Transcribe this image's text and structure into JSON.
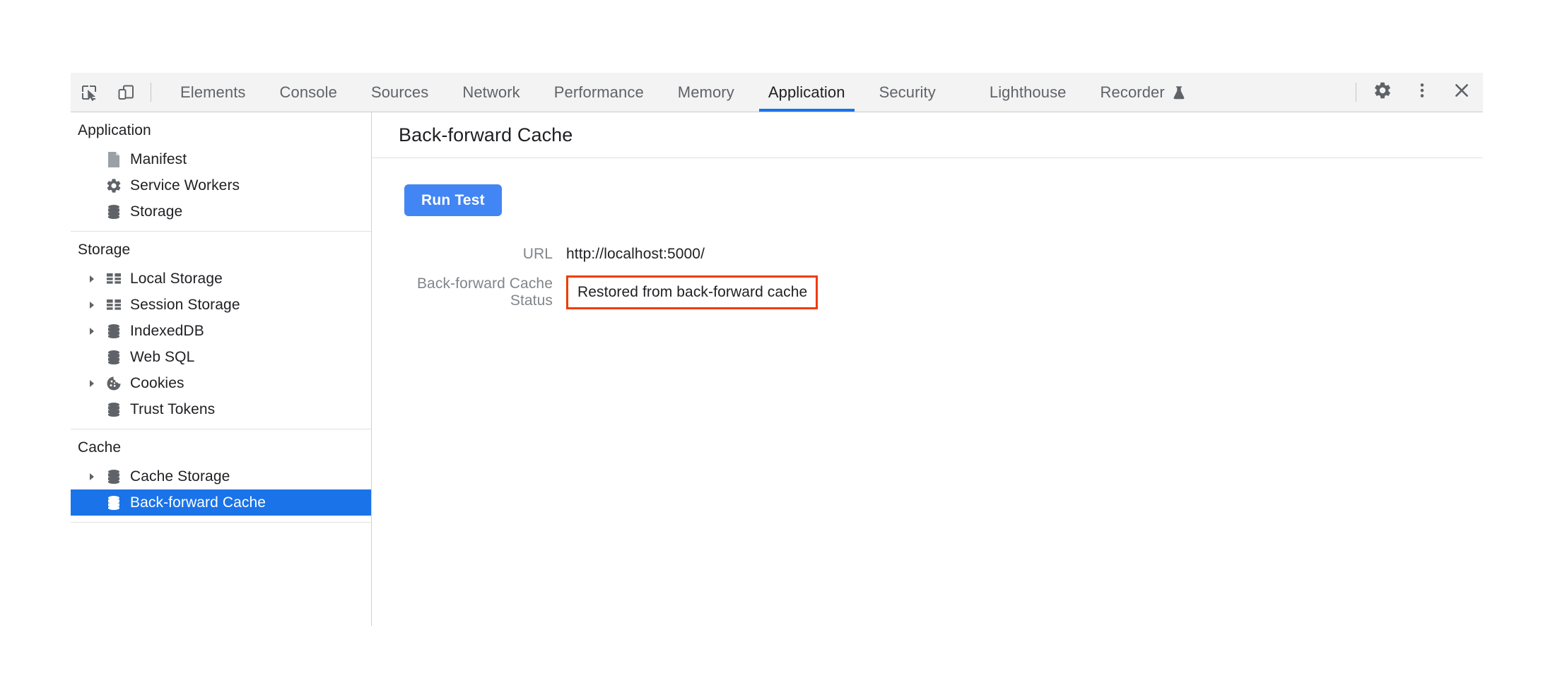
{
  "toolbar": {
    "inspect_icon": "inspect-cursor-icon",
    "device_icon": "device-toolbar-icon",
    "tabs": [
      {
        "label": "Elements",
        "active": false
      },
      {
        "label": "Console",
        "active": false
      },
      {
        "label": "Sources",
        "active": false
      },
      {
        "label": "Network",
        "active": false
      },
      {
        "label": "Performance",
        "active": false
      },
      {
        "label": "Memory",
        "active": false
      },
      {
        "label": "Application",
        "active": true
      },
      {
        "label": "Security",
        "active": false
      },
      {
        "label": "Lighthouse",
        "active": false
      },
      {
        "label": "Recorder",
        "active": false,
        "badge_icon": "flask-icon"
      }
    ],
    "settings_icon": "gear-icon",
    "more_icon": "more-vertical-icon",
    "close_icon": "close-icon"
  },
  "sidebar": {
    "sections": [
      {
        "title": "Application",
        "items": [
          {
            "label": "Manifest",
            "icon": "document-icon",
            "expandable": false,
            "selected": false
          },
          {
            "label": "Service Workers",
            "icon": "gear-icon",
            "expandable": false,
            "selected": false
          },
          {
            "label": "Storage",
            "icon": "database-icon",
            "expandable": false,
            "selected": false
          }
        ]
      },
      {
        "title": "Storage",
        "items": [
          {
            "label": "Local Storage",
            "icon": "table-icon",
            "expandable": true,
            "selected": false
          },
          {
            "label": "Session Storage",
            "icon": "table-icon",
            "expandable": true,
            "selected": false
          },
          {
            "label": "IndexedDB",
            "icon": "database-icon",
            "expandable": true,
            "selected": false
          },
          {
            "label": "Web SQL",
            "icon": "database-icon",
            "expandable": false,
            "selected": false
          },
          {
            "label": "Cookies",
            "icon": "cookie-icon",
            "expandable": true,
            "selected": false
          },
          {
            "label": "Trust Tokens",
            "icon": "database-icon",
            "expandable": false,
            "selected": false
          }
        ]
      },
      {
        "title": "Cache",
        "items": [
          {
            "label": "Cache Storage",
            "icon": "database-icon",
            "expandable": true,
            "selected": false
          },
          {
            "label": "Back-forward Cache",
            "icon": "database-icon",
            "expandable": false,
            "selected": true
          }
        ]
      }
    ]
  },
  "panel": {
    "title": "Back-forward Cache",
    "run_test_label": "Run Test",
    "report": [
      {
        "key": "URL",
        "value": "http://localhost:5000/",
        "highlighted": false
      },
      {
        "key": "Back-forward Cache Status",
        "value": "Restored from back-forward cache",
        "highlighted": true
      }
    ]
  },
  "colors": {
    "accent_blue": "#1a73e8",
    "button_blue": "#4285f4",
    "highlight_red": "#f03c02",
    "toolbar_bg": "#f3f3f3",
    "muted_text": "#80868b"
  }
}
